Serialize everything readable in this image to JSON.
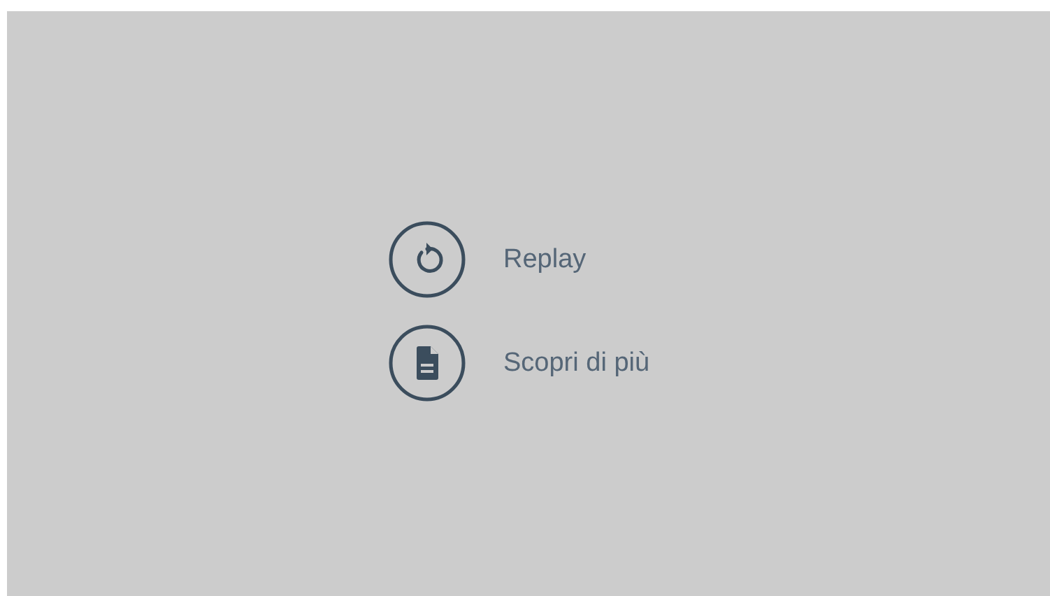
{
  "actions": [
    {
      "kind": "replay",
      "label": "Replay"
    },
    {
      "kind": "document",
      "label": "Scopri di più"
    }
  ]
}
